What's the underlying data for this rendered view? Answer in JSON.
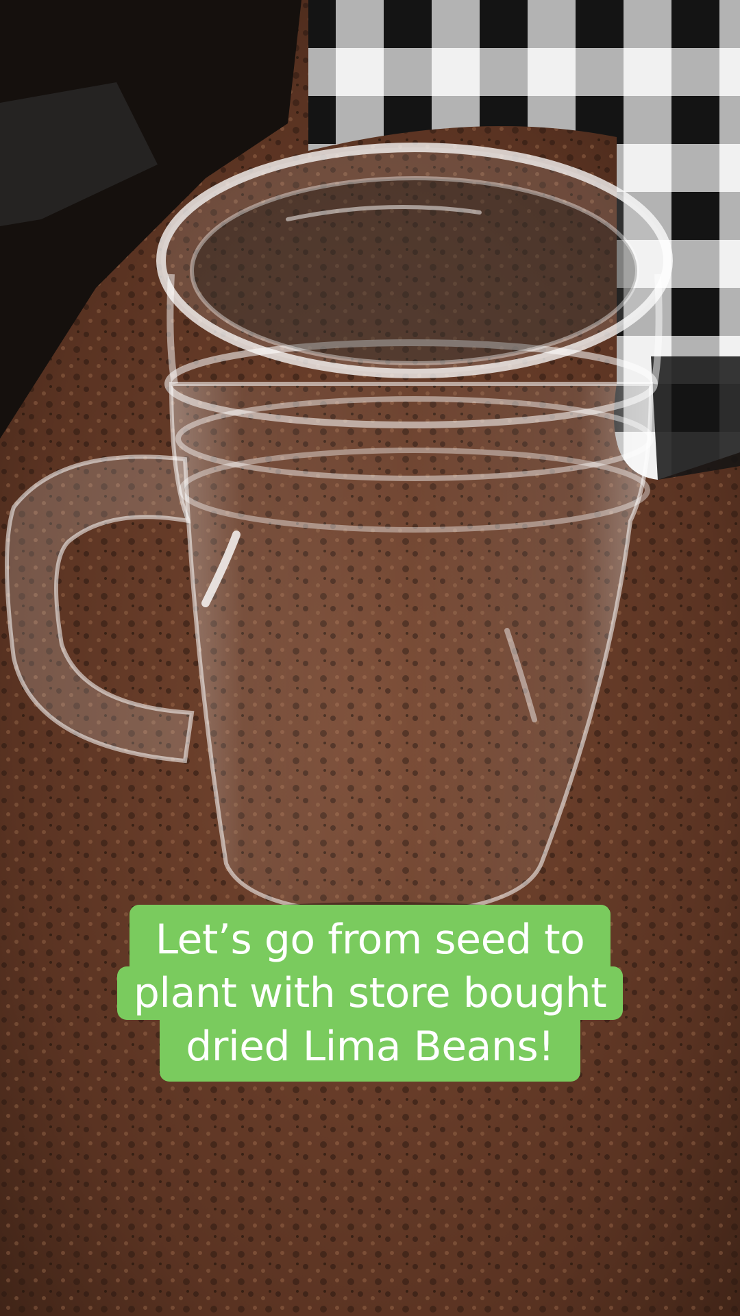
{
  "scene": {
    "subject": "glass-mason-jar-mug",
    "background": "granite-countertop",
    "colors": {
      "countertop": "#5a3322",
      "countertop_dark": "#2a1810",
      "countertop_light": "#8a5a40",
      "plaid_dark": "#1a1a1a",
      "plaid_light": "#f2f2f2",
      "glass_highlight": "#ffffff",
      "caption_bg": "#7acb5e",
      "caption_text": "#ffffff"
    }
  },
  "caption": {
    "lines": [
      "Let’s go from seed to",
      "plant with store bought",
      "dried Lima Beans!"
    ]
  }
}
